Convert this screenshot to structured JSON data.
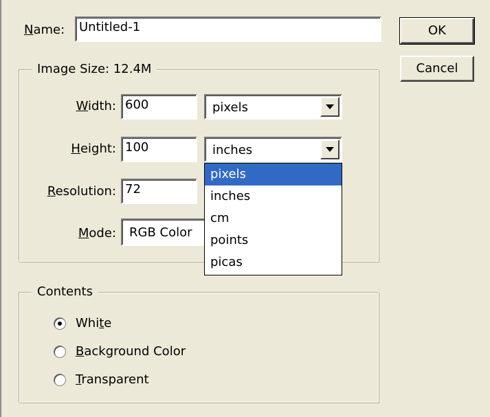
{
  "name_field": {
    "label_u": "N",
    "label_rest": "ame:",
    "value": "Untitled-1"
  },
  "image_size": {
    "legend": "Image Size: 12.4M"
  },
  "width": {
    "label_u": "W",
    "label_rest": "idth:",
    "value": "600",
    "unit": "pixels"
  },
  "height": {
    "label_u": "H",
    "label_rest": "eight:",
    "value": "100",
    "unit": "inches"
  },
  "resolution": {
    "label_u": "R",
    "label_rest": "esolution:",
    "value": "72"
  },
  "mode": {
    "label_u": "M",
    "label_rest": "ode:",
    "value": "RGB Color"
  },
  "buttons": {
    "ok": "OK",
    "cancel": "Cancel"
  },
  "unit_dropdown": {
    "selected_index": 0,
    "options": [
      "pixels",
      "inches",
      "cm",
      "points",
      "picas"
    ]
  },
  "contents": {
    "legend": "Contents",
    "options": [
      {
        "pre": "Whi",
        "u": "t",
        "post": "e",
        "checked": true
      },
      {
        "pre": "",
        "u": "B",
        "post": "ackground Color",
        "checked": false
      },
      {
        "pre": "",
        "u": "T",
        "post": "ransparent",
        "checked": false
      }
    ]
  }
}
